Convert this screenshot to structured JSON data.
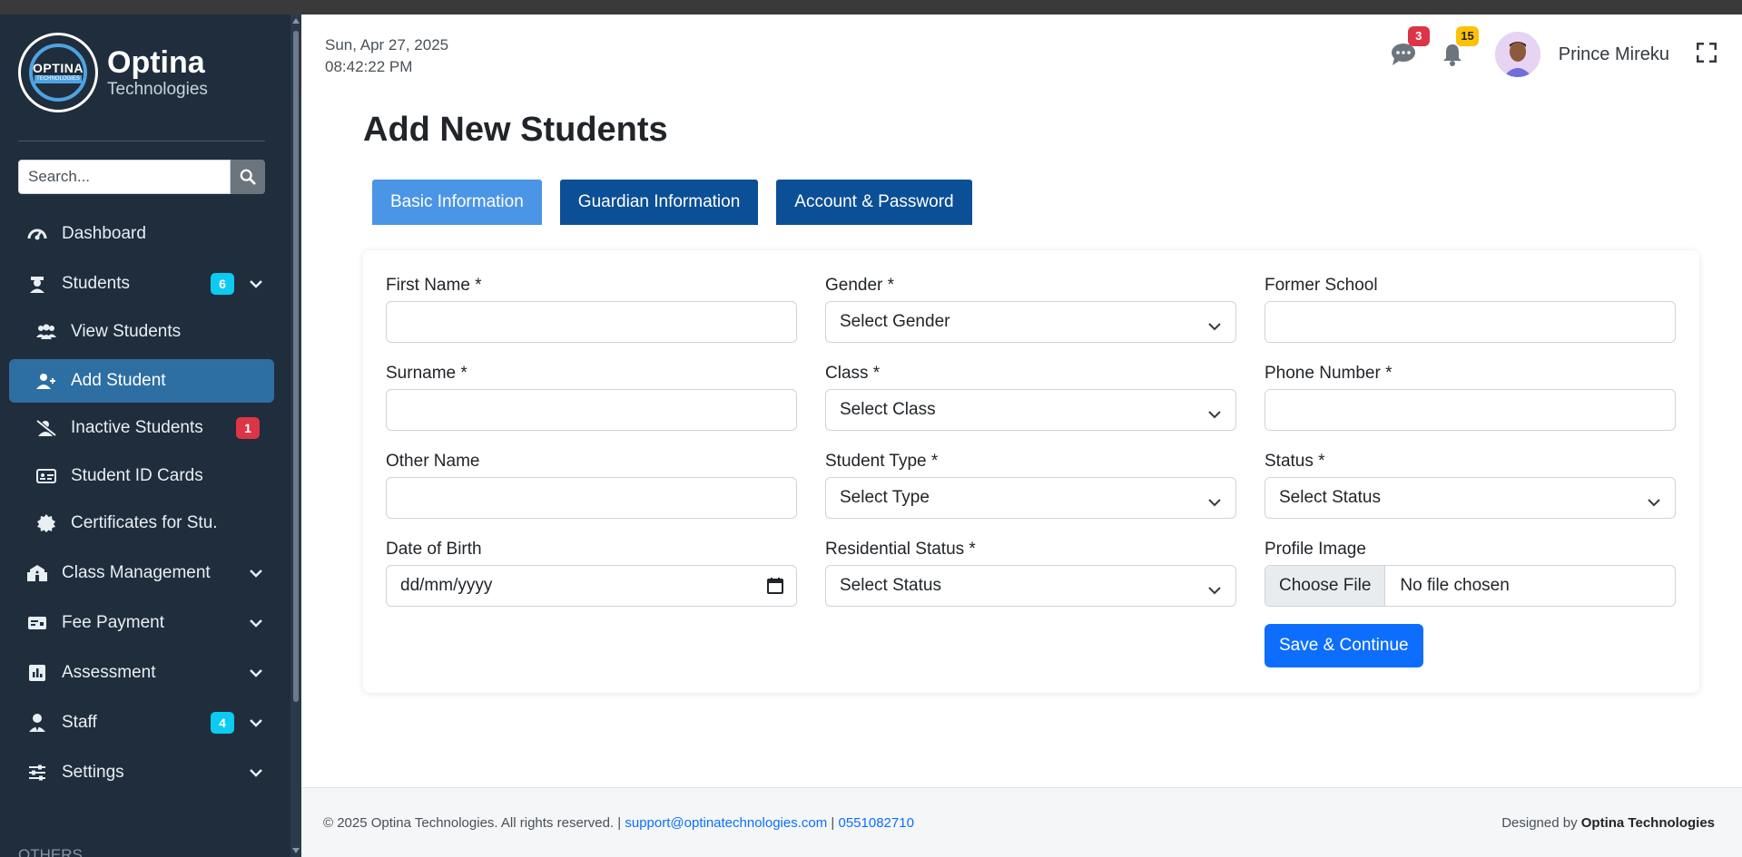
{
  "brand": {
    "logo_word": "OPTINA",
    "logo_sub": "TECHNOLOGIES",
    "name": "Optina",
    "sub": "Technologies"
  },
  "sidebar": {
    "search_placeholder": "Search...",
    "items": [
      {
        "label": "Dashboard",
        "icon": "gauge-icon"
      },
      {
        "label": "Students",
        "badge": "6",
        "icon": "student-icon"
      },
      {
        "label": "View Students",
        "icon": "users-icon"
      },
      {
        "label": "Add Student",
        "icon": "user-plus-icon"
      },
      {
        "label": "Inactive Students",
        "badge": "1",
        "icon": "user-slash-icon"
      },
      {
        "label": "Student ID Cards",
        "icon": "id-card-icon"
      },
      {
        "label": "Certificates for Stu.",
        "icon": "certificate-icon"
      },
      {
        "label": "Class Management",
        "icon": "school-icon"
      },
      {
        "label": "Fee Payment",
        "icon": "money-check-icon"
      },
      {
        "label": "Assessment",
        "icon": "chart-icon"
      },
      {
        "label": "Staff",
        "badge": "4",
        "icon": "user-tie-icon"
      },
      {
        "label": "Settings",
        "icon": "sliders-icon"
      }
    ],
    "others_label": "OTHERS"
  },
  "header": {
    "date": "Sun, Apr 27, 2025",
    "time": "08:42:22 PM",
    "messages_count": "3",
    "notifications_count": "15",
    "user_name": "Prince Mireku"
  },
  "main": {
    "title": "Add New Students",
    "tabs": [
      "Basic Information",
      "Guardian Information",
      "Account & Password"
    ],
    "fields": {
      "first_name": "First Name *",
      "surname": "Surname *",
      "other_name": "Other Name",
      "dob": "Date of Birth",
      "dob_placeholder": "dd/mm/yyyy",
      "gender": "Gender *",
      "gender_value": "Select Gender",
      "class": "Class *",
      "class_value": "Select Class",
      "student_type": "Student Type *",
      "student_type_value": "Select Type",
      "residential": "Residential Status *",
      "residential_value": "Select Status",
      "former_school": "Former School",
      "phone": "Phone Number *",
      "status": "Status *",
      "status_value": "Select Status",
      "profile_image": "Profile Image",
      "choose_file": "Choose File",
      "no_file": "No file chosen"
    },
    "save_label": "Save & Continue"
  },
  "footer": {
    "copyright": "© 2025 Optina Technologies. All rights reserved. |",
    "email": "support@optinatechnologies.com",
    "sep": "|",
    "phone": "0551082710",
    "designed_by": "Designed by",
    "company": "Optina Technologies"
  },
  "colors": {
    "sidebar_bg": "#1f2d3d",
    "active_item": "#2d6fa3",
    "tab_active": "#4a95e6",
    "tab": "#0b4f96",
    "primary": "#0d6efd"
  }
}
